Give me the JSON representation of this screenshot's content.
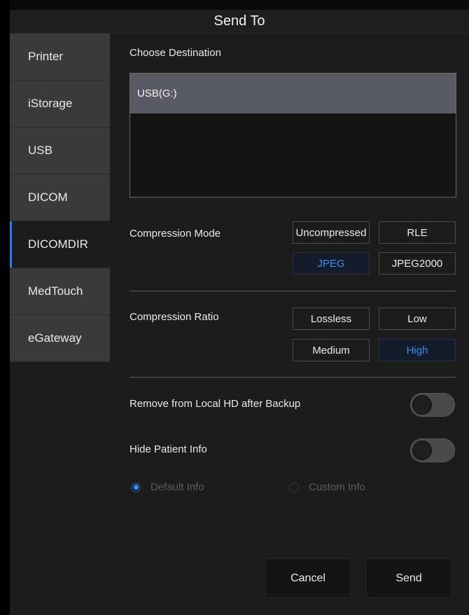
{
  "window": {
    "title": "Send To"
  },
  "sidebar": {
    "items": [
      {
        "label": "Printer"
      },
      {
        "label": "iStorage"
      },
      {
        "label": "USB"
      },
      {
        "label": "DICOM"
      },
      {
        "label": "DICOMDIR"
      },
      {
        "label": "MedTouch"
      },
      {
        "label": "eGateway"
      }
    ],
    "active": "DICOMDIR"
  },
  "destination": {
    "label": "Choose Destination",
    "items": [
      {
        "label": "USB(G:)"
      }
    ]
  },
  "compression_mode": {
    "label": "Compression Mode",
    "options": [
      "Uncompressed",
      "RLE",
      "JPEG",
      "JPEG2000"
    ],
    "selected": "JPEG"
  },
  "compression_ratio": {
    "label": "Compression Ratio",
    "options": [
      "Lossless",
      "Low",
      "Medium",
      "High"
    ],
    "selected": "High"
  },
  "remove_after_backup": {
    "label": "Remove from Local HD after Backup",
    "on": false
  },
  "hide_patient_info": {
    "label": "Hide Patient Info",
    "on": false
  },
  "info_mode": {
    "options": [
      "Default Info",
      "Custom Info"
    ],
    "selected": "Default Info",
    "enabled": false
  },
  "actions": {
    "cancel": "Cancel",
    "send": "Send"
  },
  "colors": {
    "accent": "#3b8ff0",
    "selected_row": "#5a5a66"
  }
}
